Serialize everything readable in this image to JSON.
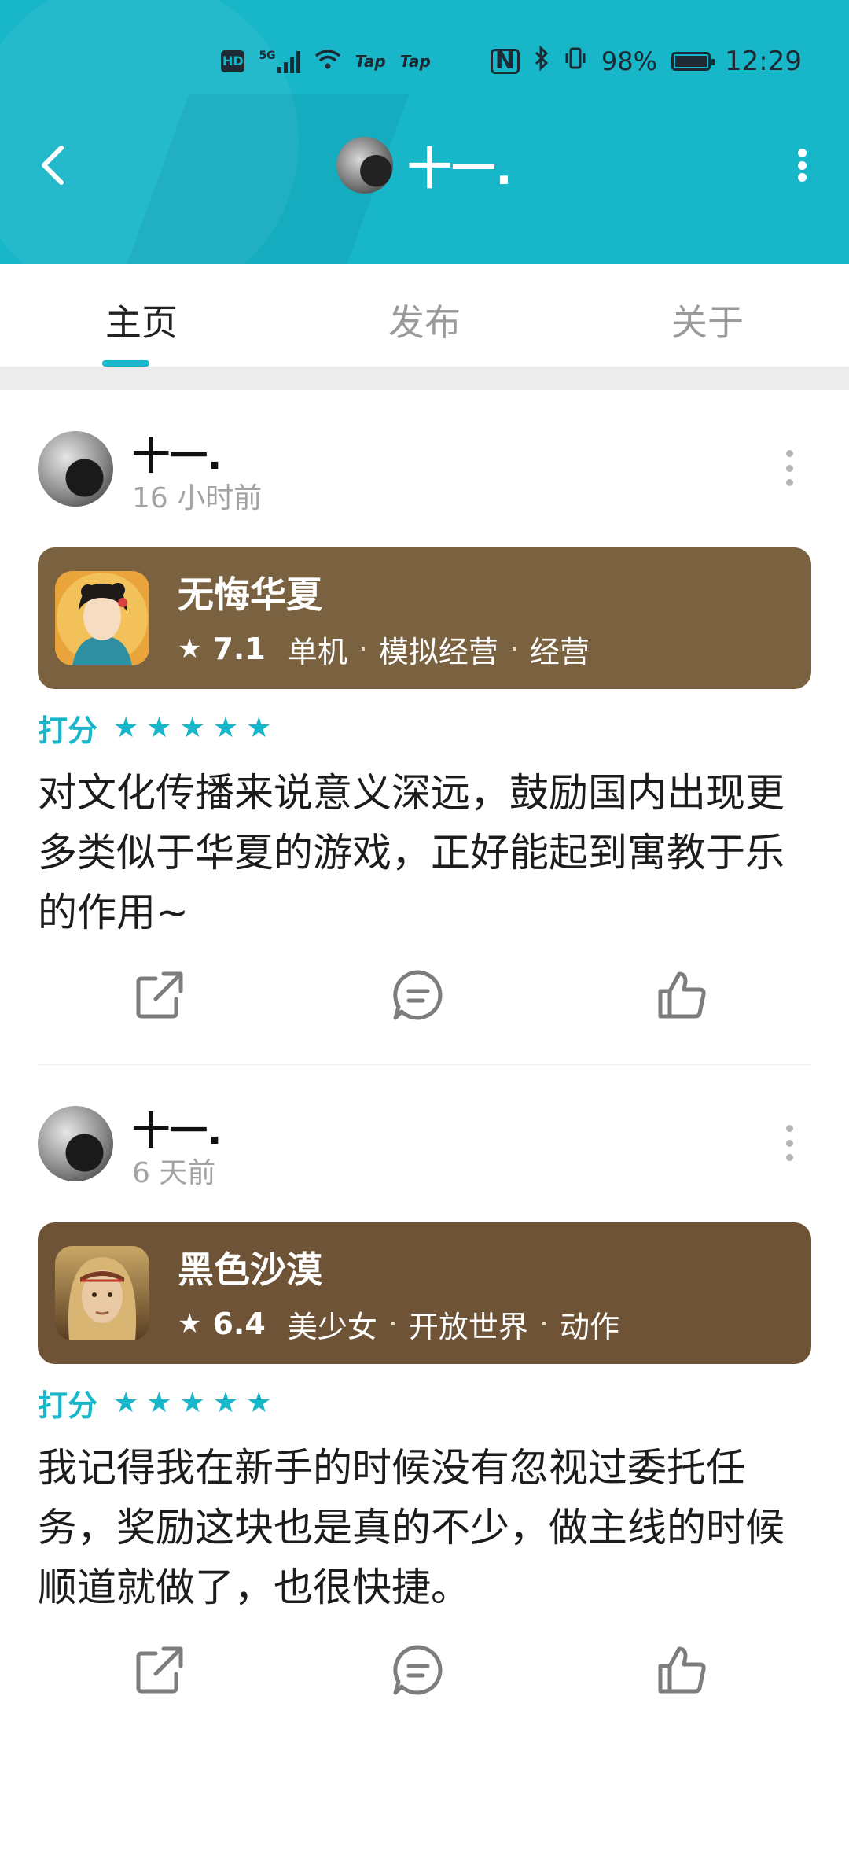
{
  "status_bar": {
    "hd_badge": "HD",
    "net_label": "5G",
    "tap1": "Tap",
    "tap2": "Tap",
    "nfc": "N",
    "battery": "98%",
    "time": "12:29"
  },
  "header": {
    "title": "十一.",
    "accent_color": "#17B6C8"
  },
  "tabs": [
    {
      "label": "主页",
      "active": true
    },
    {
      "label": "发布",
      "active": false
    },
    {
      "label": "关于",
      "active": false
    }
  ],
  "posts": [
    {
      "author": "十一.",
      "time": "16 小时前",
      "game": {
        "name": "无悔华夏",
        "score": "7.1",
        "tags": [
          "单机",
          "模拟经营",
          "经营"
        ],
        "card_color": "#7A613F"
      },
      "rating_label": "打分",
      "stars": 5,
      "review": "对文化传播来说意义深远，鼓励国内出现更多类似于华夏的游戏，正好能起到寓教于乐的作用~"
    },
    {
      "author": "十一.",
      "time": "6 天前",
      "game": {
        "name": "黑色沙漠",
        "score": "6.4",
        "tags": [
          "美少女",
          "开放世界",
          "动作"
        ],
        "card_color": "#6E5336"
      },
      "rating_label": "打分",
      "stars": 5,
      "review": "我记得我在新手的时候没有忽视过委托任务，奖励这块也是真的不少，做主线的时候顺道就做了，也很快捷。"
    }
  ],
  "icons": {
    "back": "back-arrow-icon",
    "menu": "more-vertical-icon",
    "share": "share-icon",
    "comment": "comment-icon",
    "like": "thumbs-up-icon"
  }
}
